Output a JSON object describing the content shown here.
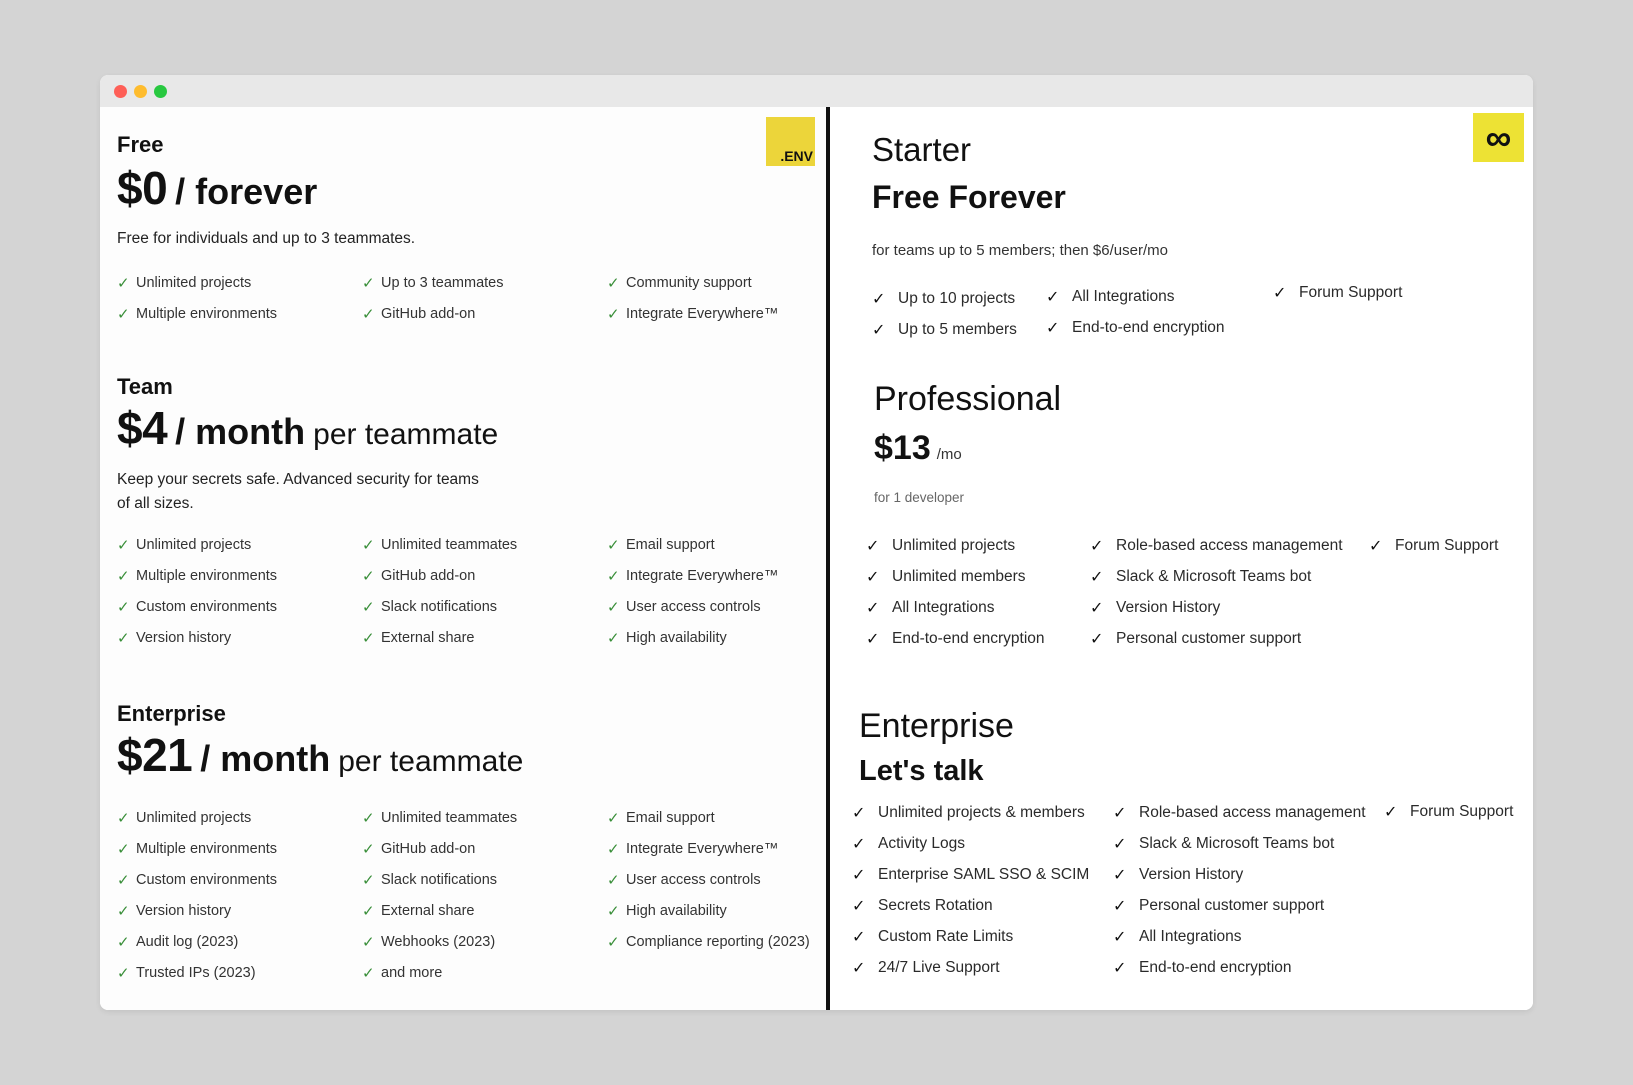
{
  "left": {
    "logo_text": ".ENV",
    "free": {
      "name": "Free",
      "amount": "$0",
      "period": "/ forever",
      "description": "Free for individuals and up to 3 teammates.",
      "features": [
        [
          "Unlimited projects",
          "Multiple environments"
        ],
        [
          "Up to 3 teammates",
          "GitHub add-on"
        ],
        [
          "Community support",
          "Integrate Everywhere™"
        ]
      ]
    },
    "team": {
      "name": "Team",
      "amount": "$4",
      "period": "/ month",
      "unit": "per teammate",
      "description_line1": "Keep your secrets safe. Advanced security for teams",
      "description_line2": "of all sizes.",
      "features": [
        [
          "Unlimited projects",
          "Multiple environments",
          "Custom environments",
          "Version history"
        ],
        [
          "Unlimited teammates",
          "GitHub add-on",
          "Slack notifications",
          "External share"
        ],
        [
          "Email support",
          "Integrate Everywhere™",
          "User access controls",
          "High availability"
        ]
      ]
    },
    "enterprise": {
      "name": "Enterprise",
      "amount": "$21",
      "period": "/ month",
      "unit": "per teammate",
      "features": [
        [
          "Unlimited projects",
          "Multiple environments",
          "Custom environments",
          "Version history",
          "Audit log (2023)",
          "Trusted IPs (2023)"
        ],
        [
          "Unlimited teammates",
          "GitHub add-on",
          "Slack notifications",
          "External share",
          "Webhooks (2023)",
          "and more"
        ],
        [
          "Email support",
          "Integrate Everywhere™",
          "User access controls",
          "High availability",
          "Compliance reporting (2023)"
        ]
      ]
    }
  },
  "right": {
    "logo_glyph": "∞",
    "starter": {
      "name": "Starter",
      "price": "Free Forever",
      "description": "for teams up to 5 members; then $6/user/mo",
      "features": [
        [
          "Up to 10 projects",
          "Up to 5 members"
        ],
        [
          "All Integrations",
          "End-to-end encryption"
        ],
        [
          "Forum Support"
        ]
      ]
    },
    "professional": {
      "name": "Professional",
      "amount": "$13",
      "period": "/mo",
      "note": "for 1 developer",
      "features": [
        [
          "Unlimited projects",
          "Unlimited members",
          "All Integrations",
          "End-to-end encryption"
        ],
        [
          "Role-based access management",
          "Slack & Microsoft Teams bot",
          "Version History",
          "Personal customer support"
        ],
        [
          "Forum Support"
        ]
      ]
    },
    "enterprise": {
      "name": "Enterprise",
      "price": "Let's talk",
      "features": [
        [
          "Unlimited projects & members",
          "Activity Logs",
          "Enterprise SAML SSO & SCIM",
          "Secrets Rotation",
          "Custom Rate Limits",
          "24/7 Live Support"
        ],
        [
          "Role-based access management",
          "Slack & Microsoft Teams bot",
          "Version History",
          "Personal customer support",
          "All Integrations",
          "End-to-end encryption"
        ],
        [
          "Forum Support"
        ]
      ]
    }
  },
  "check_glyph": "✓"
}
